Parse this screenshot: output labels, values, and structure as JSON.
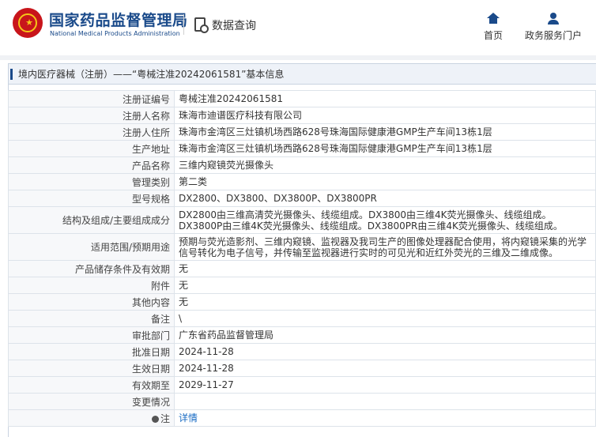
{
  "header": {
    "brand_cn": "国家药品监督管理局",
    "brand_en": "National Medical Products Administration",
    "data_query": "数据查询",
    "nav": {
      "home": "首页",
      "portal": "政务服务门户"
    }
  },
  "panel": {
    "title": "境内医疗器械（注册）——“粤械注准20242061581”基本信息"
  },
  "rows": [
    {
      "key": "注册证编号",
      "value": "粤械注准20242061581"
    },
    {
      "key": "注册人名称",
      "value": "珠海市迪谱医疗科技有限公司"
    },
    {
      "key": "注册人住所",
      "value": "珠海市金湾区三灶镇机场西路628号珠海国际健康港GMP生产车间13栋1层"
    },
    {
      "key": "生产地址",
      "value": "珠海市金湾区三灶镇机场西路628号珠海国际健康港GMP生产车间13栋1层"
    },
    {
      "key": "产品名称",
      "value": "三维内窥镜荧光摄像头"
    },
    {
      "key": "管理类别",
      "value": "第二类"
    },
    {
      "key": "型号规格",
      "value": "DX2800、DX3800、DX3800P、DX3800PR"
    },
    {
      "key": "结构及组成/主要组成成分",
      "value": "DX2800由三维高清荧光摄像头、线缆组成。DX3800由三维4K荧光摄像头、线缆组成。DX3800P由三维4K荧光摄像头、线缆组成。DX3800PR由三维4K荧光摄像头、线缆组成。"
    },
    {
      "key": "适用范围/预期用途",
      "value": "预期与荧光造影剂、三维内窥镜、监视器及我司生产的图像处理器配合使用，将内窥镜采集的光学信号转化为电子信号，并传输至监视器进行实时的可见光和近红外荧光的三维及二维成像。"
    },
    {
      "key": "产品储存条件及有效期",
      "value": "无"
    },
    {
      "key": "附件",
      "value": "无"
    },
    {
      "key": "其他内容",
      "value": "无"
    },
    {
      "key": "备注",
      "value": "\\"
    },
    {
      "key": "审批部门",
      "value": "广东省药品监督管理局"
    },
    {
      "key": "批准日期",
      "value": "2024-11-28"
    },
    {
      "key": "生效日期",
      "value": "2024-11-28"
    },
    {
      "key": "有效期至",
      "value": "2029-11-27"
    },
    {
      "key": "变更情况",
      "value": ""
    },
    {
      "key": "注",
      "value": "详情"
    }
  ]
}
